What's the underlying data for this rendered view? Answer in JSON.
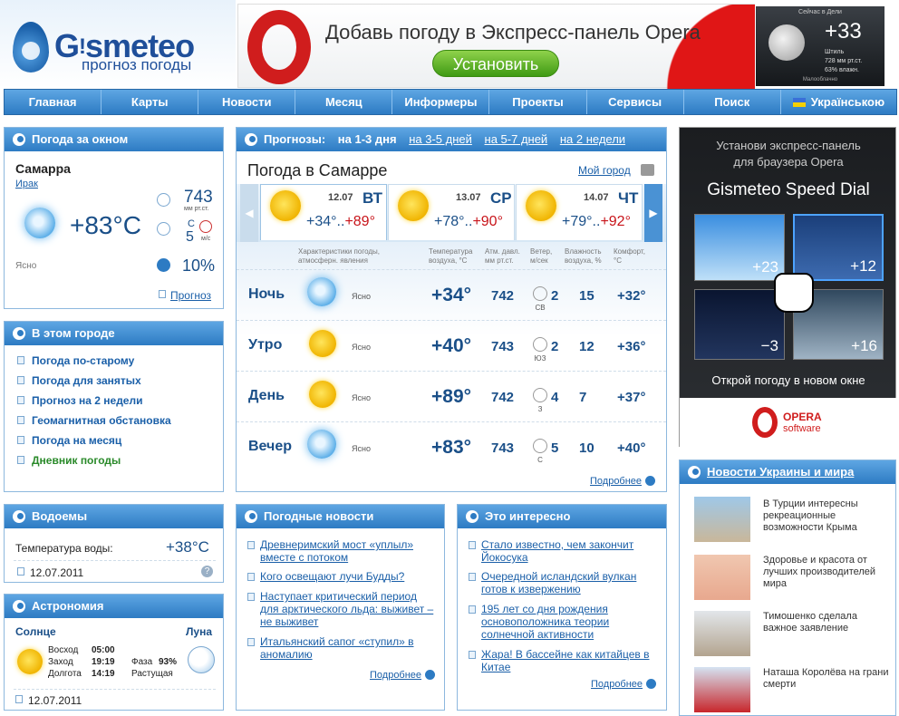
{
  "header": {
    "logo_brand_pre": "G",
    "logo_brand_i": "!",
    "logo_brand_post": "smeteo",
    "logo_subtitle": "прогноз погоды",
    "banner_text": "Добавь погоду в Экспресс-панель Opera",
    "banner_button": "Установить",
    "mini_title": "Сейчас в Дели",
    "mini_temp": "+33",
    "mini_d1": "Штиль",
    "mini_d2": "728 мм рт.ст.",
    "mini_d3": "63% влажн.",
    "mini_bottom": "Малооблачно"
  },
  "nav": [
    "Главная",
    "Карты",
    "Новости",
    "Месяц",
    "Информеры",
    "Проекты",
    "Сервисы",
    "Поиск",
    "Українською"
  ],
  "window": {
    "title": "Погода за окном",
    "city": "Самарра",
    "country": "Ирак",
    "temp": "+83°C",
    "pressure": "743",
    "pressure_unit": "мм рт.ст.",
    "wind_dir": "С",
    "wind_speed": "5",
    "wind_unit": "м/с",
    "state": "Ясно",
    "humidity": "10%",
    "forecast_link": "Прогноз"
  },
  "city_box": {
    "title": "В этом городе",
    "links": [
      "Погода по-старому",
      "Погода для занятых",
      "Прогноз на 2 недели",
      "Геомагнитная обстановка",
      "Погода на месяц",
      "Дневник погоды"
    ]
  },
  "water": {
    "title": "Водоемы",
    "label": "Температура воды:",
    "temp": "+38°C",
    "date": "12.07.2011"
  },
  "astro": {
    "title": "Астрономия",
    "sun_label": "Солнце",
    "moon_label": "Луна",
    "rise_l": "Восход",
    "rise": "05:00",
    "set_l": "Заход",
    "set": "19:19",
    "len_l": "Долгота",
    "len": "14:19",
    "phase_l": "Фаза",
    "phase": "93%",
    "growth": "Растущая",
    "date": "12.07.2011"
  },
  "forecast": {
    "header_label": "Прогнозы:",
    "tabs": [
      "на 1-3 дня",
      "на 3-5 дней",
      "на 5-7 дней",
      "на 2 недели"
    ],
    "title": "Погода в Самарре",
    "my_city": "Мой город",
    "days": [
      {
        "date": "12.07",
        "wd": "ВТ",
        "tmin": "+34°",
        "tmax": "+89°"
      },
      {
        "date": "13.07",
        "wd": "СР",
        "tmin": "+78°",
        "tmax": "+90°"
      },
      {
        "date": "14.07",
        "wd": "ЧТ",
        "tmin": "+79°",
        "tmax": "+92°"
      }
    ],
    "cols": [
      "Характеристики погоды, атмосферн. явления",
      "Температура воздуха, °С",
      "Атм. давл. мм рт.ст.",
      "Ветер, м/сек",
      "Влажность воздуха, %",
      "Комфорт, °С"
    ],
    "rows": [
      {
        "name": "Ночь",
        "state": "Ясно",
        "temp": "+34°",
        "press": "742",
        "wdir": "СВ",
        "wspeed": "2",
        "hum": "15",
        "comfort": "+32°",
        "icon": "moon"
      },
      {
        "name": "Утро",
        "state": "Ясно",
        "temp": "+40°",
        "press": "743",
        "wdir": "ЮЗ",
        "wspeed": "2",
        "hum": "12",
        "comfort": "+36°",
        "icon": "sun"
      },
      {
        "name": "День",
        "state": "Ясно",
        "temp": "+89°",
        "press": "742",
        "wdir": "З",
        "wspeed": "4",
        "hum": "7",
        "comfort": "+37°",
        "icon": "sun"
      },
      {
        "name": "Вечер",
        "state": "Ясно",
        "temp": "+83°",
        "press": "743",
        "wdir": "С",
        "wspeed": "5",
        "hum": "10",
        "comfort": "+40°",
        "icon": "moon"
      }
    ],
    "more": "Подробнее"
  },
  "ad": {
    "l1": "Установи экспресс-панель",
    "l2": "для браузера Opera",
    "title": "Gismeteo Speed Dial",
    "tiles": [
      "+23",
      "+12",
      "−3",
      "+16"
    ],
    "cta": "Открой погоду в новом окне",
    "opera": "OPERA",
    "software": "software"
  },
  "wnews": {
    "title": "Погодные новости",
    "items": [
      "Древнеримский мост «уплыл» вместе с потоком",
      "Кого освещают лучи Будды?",
      "Наступает критический период для арктического льда: выживет – не выживет",
      "Итальянский сапог «ступил» в аномалию"
    ],
    "more": "Подробнее"
  },
  "interesting": {
    "title": "Это интересно",
    "items": [
      "Стало известно, чем закончит Йокосука",
      "Очередной исландский вулкан готов к извержению",
      "195 лет со дня рождения основоположника теории солнечной активности",
      "Жара! В бассейне как китайцев в Китае"
    ],
    "more": "Подробнее"
  },
  "unews": {
    "title": "Новости Украины и мира",
    "items": [
      "В Турции интересны рекреационные возможности Крыма",
      "Здоровье и красота от лучших производителей мира",
      "Тимошенко сделала важное заявление",
      "Наташа Королёва на грани смерти"
    ]
  }
}
